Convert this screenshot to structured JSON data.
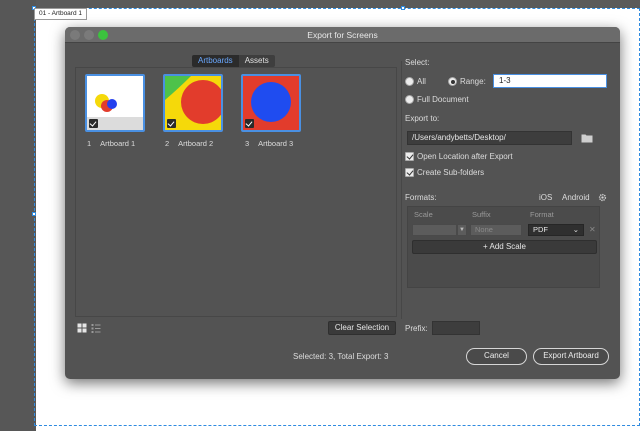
{
  "canvas": {
    "artboard_label": "01 - Artboard 1"
  },
  "dialog": {
    "title": "Export for Screens",
    "tabs": [
      {
        "label": "Artboards",
        "active": true
      },
      {
        "label": "Assets",
        "active": false
      }
    ],
    "artboards": [
      {
        "number": "1",
        "name": "Artboard 1",
        "selected": true
      },
      {
        "number": "2",
        "name": "Artboard 2",
        "selected": true
      },
      {
        "number": "3",
        "name": "Artboard 3",
        "selected": true
      }
    ],
    "select": {
      "label": "Select:",
      "all_label": "All",
      "range_label": "Range:",
      "range_value": "1-3",
      "full_document_label": "Full Document",
      "selected_option": "Range"
    },
    "export_to": {
      "label": "Export to:",
      "path": "/Users/andybetts/Desktop/",
      "open_location_label": "Open Location after Export",
      "open_location_checked": true,
      "create_subfolders_label": "Create Sub-folders",
      "create_subfolders_checked": true
    },
    "formats": {
      "label": "Formats:",
      "ios_label": "iOS",
      "android_label": "Android",
      "columns": [
        "Scale",
        "Suffix",
        "Format"
      ],
      "row": {
        "scale": "",
        "suffix_placeholder": "None",
        "format": "PDF"
      },
      "add_scale_label": "Add Scale"
    },
    "clear_selection_label": "Clear Selection",
    "prefix_label": "Prefix:",
    "prefix_value": "",
    "status": "Selected: 3, Total Export: 3",
    "cancel_label": "Cancel",
    "export_label": "Export Artboard"
  },
  "colors": {
    "accent": "#4a90e2",
    "dialog_bg": "#535353",
    "maximize_green": "#3cc23e"
  }
}
